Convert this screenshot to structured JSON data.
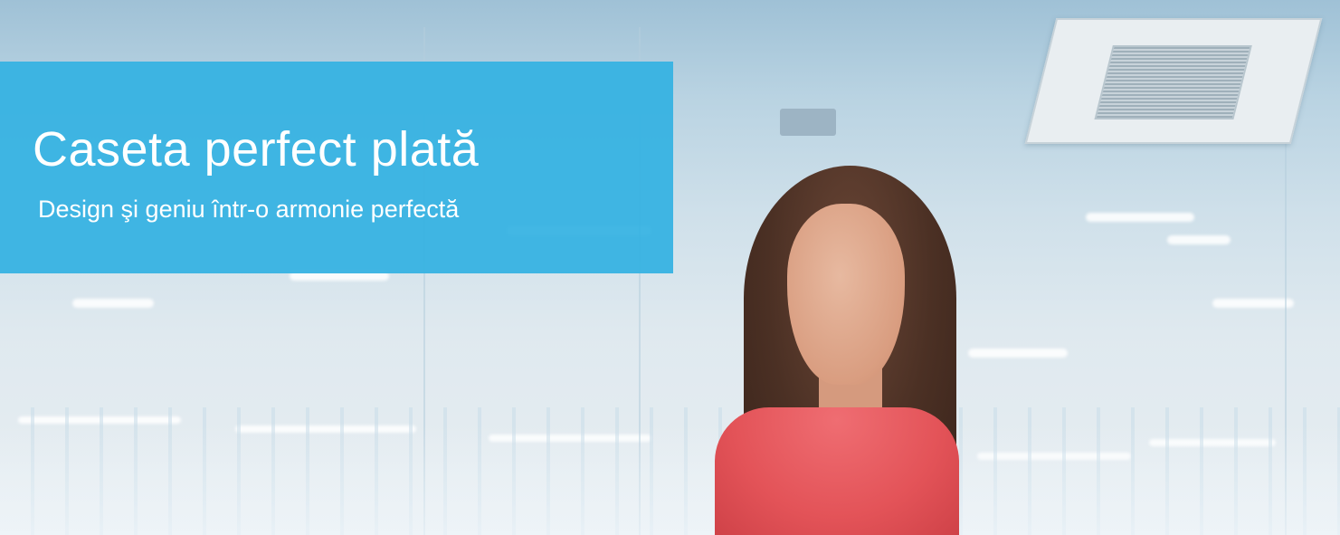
{
  "banner": {
    "title": "Caseta perfect plată",
    "subtitle": "Design şi geniu într-o armonie perfectă",
    "color": "#34b2e2"
  },
  "photo": {
    "accent_shirt": "#e35358",
    "background_tone": "#cfe0ea"
  }
}
